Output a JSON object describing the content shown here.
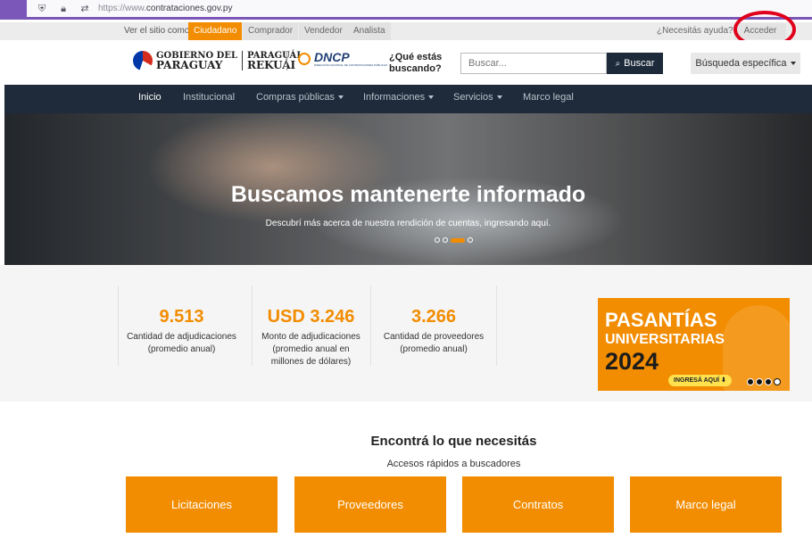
{
  "browser": {
    "url_proto": "https://www.",
    "url_host": "contrataciones.gov.py"
  },
  "topstrip": {
    "view_as": "Ver el sitio como:",
    "roles": [
      "Ciudadano",
      "Comprador",
      "Vendedor",
      "Analista"
    ],
    "active_role": "Ciudadano",
    "help": "¿Necesitás ayuda?",
    "login": "Acceder"
  },
  "header": {
    "gov_logo": {
      "line1": "GOBIERNO DEL",
      "line2": "PARAGUAY",
      "line3": "PARAGUÁI",
      "line4": "REKUÁI"
    },
    "dncp_logo": {
      "name": "DNCP",
      "sub": "DIRECCIÓN NACIONAL DE CONTRATACIONES PÚBLICAS"
    },
    "ask_line1": "¿Qué estás",
    "ask_line2": "buscando?",
    "search_placeholder": "Buscar...",
    "search_button": "Buscar",
    "advanced_search": "Búsqueda específica"
  },
  "nav": {
    "items": [
      {
        "label": "Inicio"
      },
      {
        "label": "Institucional"
      },
      {
        "label": "Compras públicas"
      },
      {
        "label": "Informaciones"
      },
      {
        "label": "Servicios"
      },
      {
        "label": "Marco legal"
      }
    ]
  },
  "hero": {
    "title": "Buscamos mantenerte informado",
    "subtitle": "Descubrí más acerca de nuestra rendición de cuentas, ingresando aquí.",
    "slide_count": 4,
    "active_slide": 3
  },
  "stats": [
    {
      "value": "9.513",
      "label_line1": "Cantidad de adjudicaciones",
      "label_line2": "(promedio anual)",
      "label_line3": ""
    },
    {
      "value": "USD 3.246",
      "label_line1": "Monto de adjudicaciones",
      "label_line2": "(promedio anual en",
      "label_line3": "millones de dólares)"
    },
    {
      "value": "3.266",
      "label_line1": "Cantidad de proveedores",
      "label_line2": "(promedio anual)",
      "label_line3": ""
    }
  ],
  "banner": {
    "line1": "PASANTÍAS",
    "line2": "UNIVERSITARIAS",
    "line3": "2024",
    "cta": "INGRESÁ AQUÍ",
    "slide_count": 4,
    "active_slide": 3
  },
  "quick": {
    "title": "Encontrá lo que necesitás",
    "subtitle": "Accesos rápidos a buscadores",
    "buttons": [
      "Licitaciones",
      "Proveedores",
      "Contratos",
      "Marco legal"
    ]
  },
  "colors": {
    "accent": "#f28c00",
    "nav_bg": "#1f2b3a",
    "annotation": "#e0001b"
  }
}
